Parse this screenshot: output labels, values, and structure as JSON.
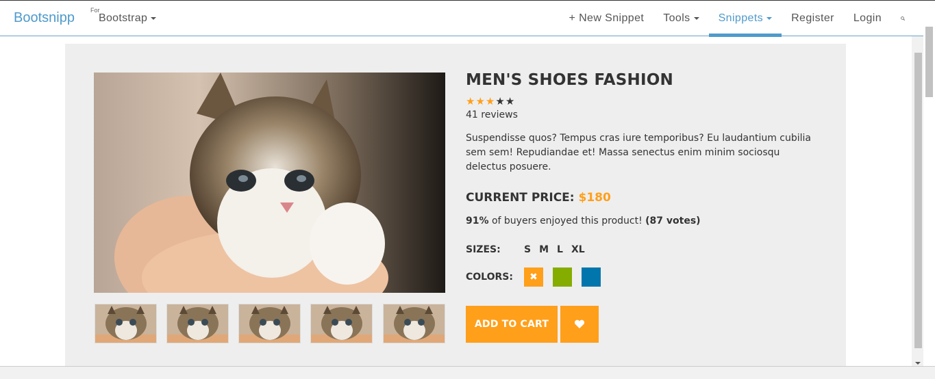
{
  "nav": {
    "brand": "Bootsnipp",
    "for_label": "For",
    "bootstrap_menu": "Bootstrap",
    "items": [
      {
        "label": "+ New Snippet",
        "caret": false,
        "active": false
      },
      {
        "label": "Tools",
        "caret": true,
        "active": false
      },
      {
        "label": "Snippets",
        "caret": true,
        "active": true
      },
      {
        "label": "Register",
        "caret": false,
        "active": false
      },
      {
        "label": "Login",
        "caret": false,
        "active": false
      }
    ],
    "search_icon": "search-icon"
  },
  "product": {
    "title": "MEN'S SHOES FASHION",
    "rating": 3,
    "rating_max": 5,
    "reviews": "41 reviews",
    "description": "Suspendisse quos? Tempus cras iure temporibus? Eu laudantium cubilia sem sem! Repudiandae et! Massa senectus enim minim sociosqu delectus posuere.",
    "price_label": "CURRENT PRICE:",
    "price": "$180",
    "vote_percent": "91%",
    "vote_text": "of buyers enjoyed this product!",
    "vote_count": "(87 votes)",
    "sizes_label": "SIZES:",
    "sizes": [
      "S",
      "M",
      "L",
      "XL"
    ],
    "colors_label": "COLORS:",
    "colors": [
      {
        "hex": "#ff9f1a",
        "selected": true,
        "mark": "✖"
      },
      {
        "hex": "#85ad00",
        "selected": false,
        "mark": ""
      },
      {
        "hex": "#0076ad",
        "selected": false,
        "mark": ""
      }
    ],
    "add_to_cart": "ADD TO CART",
    "like_icon": "heart-icon"
  },
  "colors": {
    "accent": "#ff9f1a",
    "brand": "#4e9acb",
    "card_bg": "#eeeeee"
  }
}
